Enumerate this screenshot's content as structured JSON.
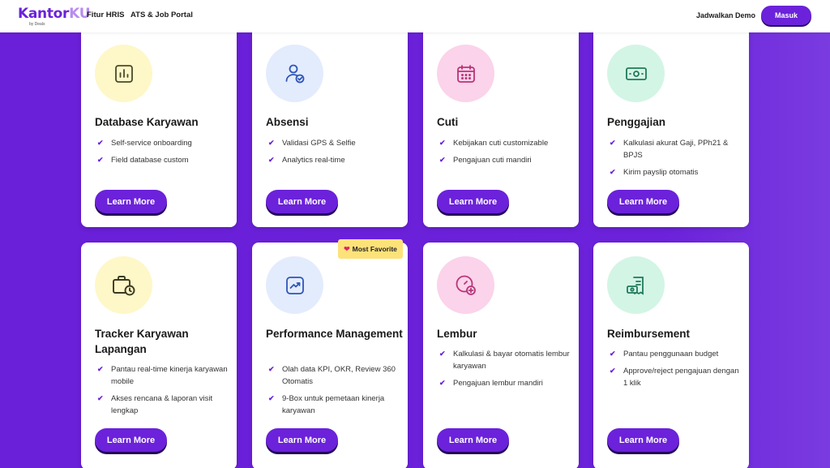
{
  "nav": {
    "logo_main_a": "Kantor",
    "logo_main_b": "KU",
    "logo_sub": "by Deals",
    "links": [
      "Fitur HRIS",
      "ATS & Job Portal"
    ],
    "demo_link": "Jadwalkan Demo",
    "login_button": "Masuk"
  },
  "badge": {
    "heart": "❤",
    "label": "Most Favorite"
  },
  "learn_more": "Learn More",
  "check": "✔",
  "cards": [
    {
      "title": "Database Karyawan",
      "icon": "chart-icon",
      "features": [
        "Self-service onboarding",
        "Field database custom"
      ]
    },
    {
      "title": "Absensi",
      "icon": "user-check-icon",
      "features": [
        "Validasi GPS & Selfie",
        "Analytics real-time"
      ]
    },
    {
      "title": "Cuti",
      "icon": "calendar-icon",
      "features": [
        "Kebijakan cuti customizable",
        "Pengajuan cuti mandiri"
      ]
    },
    {
      "title": "Penggajian",
      "icon": "money-icon",
      "features": [
        "Kalkulasi akurat Gaji, PPh21 & BPJS",
        "Kirim payslip otomatis"
      ]
    },
    {
      "title": "Tracker Karyawan Lapangan",
      "icon": "briefcase-clock-icon",
      "features": [
        "Pantau real-time kinerja karyawan mobile",
        "Akses rencana & laporan visit lengkap"
      ]
    },
    {
      "title": "Performance Management",
      "icon": "trend-icon",
      "features": [
        "Olah data KPI, OKR, Review 360 Otomatis",
        "9-Box untuk pemetaan kinerja karyawan"
      ]
    },
    {
      "title": "Lembur",
      "icon": "clock-plus-icon",
      "features": [
        "Kalkulasi & bayar otomatis lembur karyawan",
        "Pengajuan lembur mandiri"
      ]
    },
    {
      "title": "Reimbursement",
      "icon": "receipt-money-icon",
      "features": [
        "Pantau penggunaan budget",
        "Approve/reject pengajuan dengan 1 klik"
      ]
    }
  ],
  "colors": {
    "accent": "#6B22DA",
    "icon_bg_yellow": "#FEF7C8",
    "icon_bg_blue": "#E3ECFD",
    "icon_bg_pink": "#FBD3EA",
    "icon_bg_green": "#D3F5E6"
  }
}
